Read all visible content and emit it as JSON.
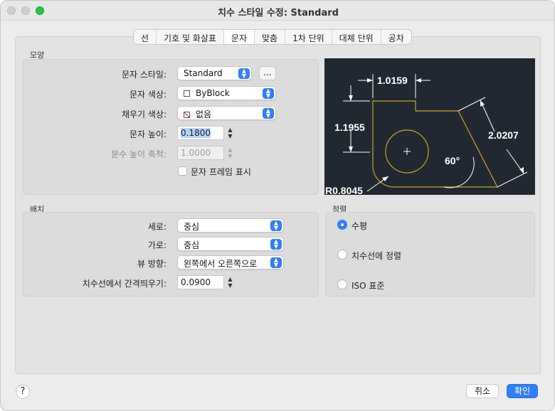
{
  "window": {
    "title": "치수 스타일 수정: Standard"
  },
  "tabs": [
    {
      "label": "선"
    },
    {
      "label": "기호 및 화살표"
    },
    {
      "label": "문자"
    },
    {
      "label": "맞춤"
    },
    {
      "label": "1차 단위"
    },
    {
      "label": "대체 단위"
    },
    {
      "label": "공차"
    }
  ],
  "active_tab": "문자",
  "appearance": {
    "section": "모양",
    "text_style": {
      "label": "문자 스타일:",
      "value": "Standard",
      "more": "..."
    },
    "text_color": {
      "label": "문자 색상:",
      "value": "ByBlock"
    },
    "fill_color": {
      "label": "채우기 색상:",
      "value": "없음"
    },
    "text_height": {
      "label": "문자 높이:",
      "value": "0.1800"
    },
    "fraction_scale": {
      "label": "분수 높이 축척:",
      "value": "1.0000"
    },
    "frame": {
      "label": "문자 프레임 표시",
      "checked": false
    }
  },
  "placement": {
    "section": "배치",
    "vertical": {
      "label": "세로:",
      "value": "중심"
    },
    "horizontal": {
      "label": "가로:",
      "value": "중심"
    },
    "view_direction": {
      "label": "뷰 방향:",
      "value": "왼쪽에서 오른쪽으로"
    },
    "offset": {
      "label": "치수선에서 간격띄우기:",
      "value": "0.0900"
    }
  },
  "alignment": {
    "section": "정렬",
    "options": [
      {
        "label": "수평",
        "selected": true
      },
      {
        "label": "치수선에 정렬",
        "selected": false
      },
      {
        "label": "ISO 표준",
        "selected": false
      }
    ]
  },
  "preview": {
    "dim_top": "1.0159",
    "dim_left": "1.1955",
    "dim_right": "2.0207",
    "angle": "60°",
    "radius": "R0.8045",
    "colors": {
      "background": "#222831",
      "geometry": "#c9a227",
      "dimension": "#ffffff"
    }
  },
  "buttons": {
    "help": "?",
    "cancel": "취소",
    "ok": "확인"
  },
  "colors": {
    "accent": "#2f7ff6"
  }
}
